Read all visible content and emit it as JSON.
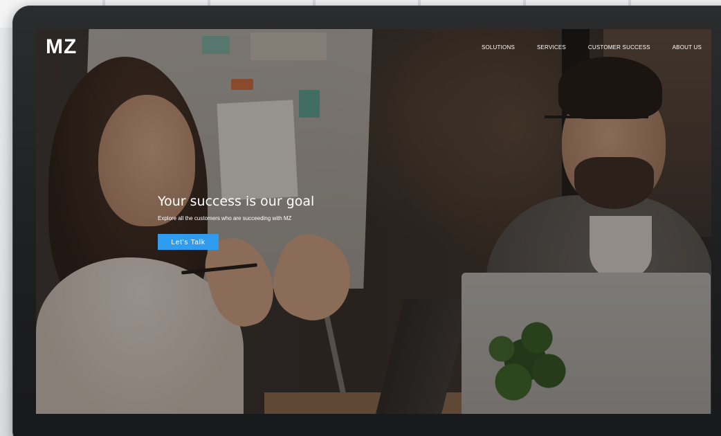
{
  "site": {
    "logo": "MZ"
  },
  "nav": {
    "items": [
      {
        "label": "SOLUTIONS"
      },
      {
        "label": "SERVICES"
      },
      {
        "label": "CUSTOMER SUCCESS"
      },
      {
        "label": "ABOUT US"
      }
    ]
  },
  "hero": {
    "title": "Your success is our goal",
    "subtitle": "Explore all the customers who are succeeding with MZ",
    "cta_label": "Let's Talk"
  },
  "colors": {
    "accent": "#2f9cf0",
    "bezel": "#1d1e20",
    "text": "#ffffff"
  }
}
